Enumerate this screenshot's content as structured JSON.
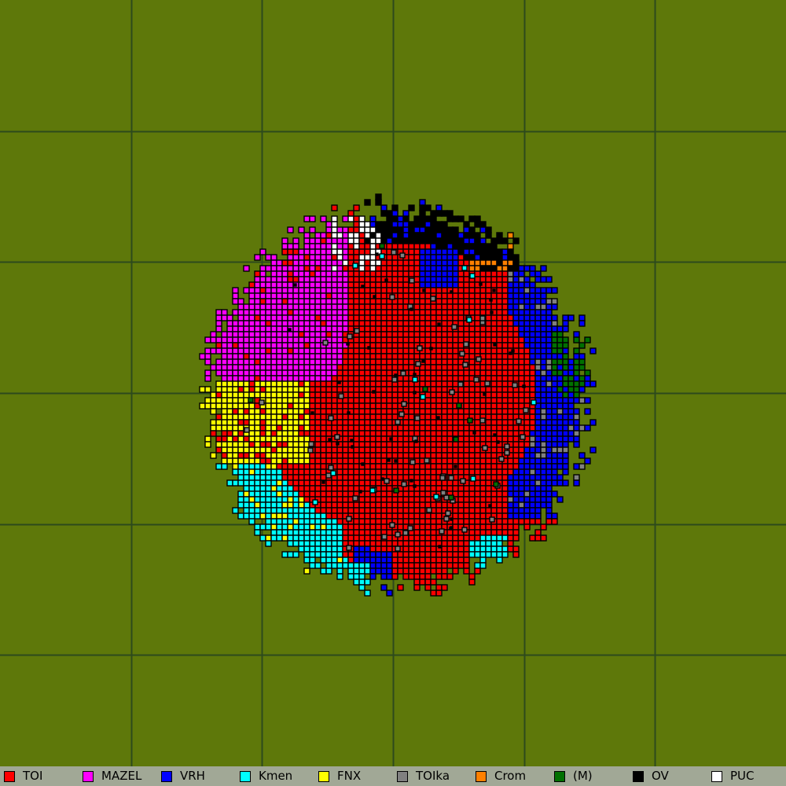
{
  "map": {
    "background_color": "#5e780a",
    "grid_color": "#2d4a1c",
    "cell_outline_color": "#000000",
    "grid_divisions": 6
  },
  "legend": {
    "items": [
      {
        "label": "TOI",
        "color": "#ff0000"
      },
      {
        "label": "MAZEL",
        "color": "#ff00ff"
      },
      {
        "label": "VRH",
        "color": "#0000ff"
      },
      {
        "label": "Kmen",
        "color": "#00ffff"
      },
      {
        "label": "FNX",
        "color": "#ffff00"
      },
      {
        "label": "TOIka",
        "color": "#808080"
      },
      {
        "label": "Crom",
        "color": "#ff8000"
      },
      {
        "label": "(M)",
        "color": "#007000"
      },
      {
        "label": "OV",
        "color": "#000000"
      },
      {
        "label": "PUC",
        "color": "#ffffff"
      }
    ]
  }
}
